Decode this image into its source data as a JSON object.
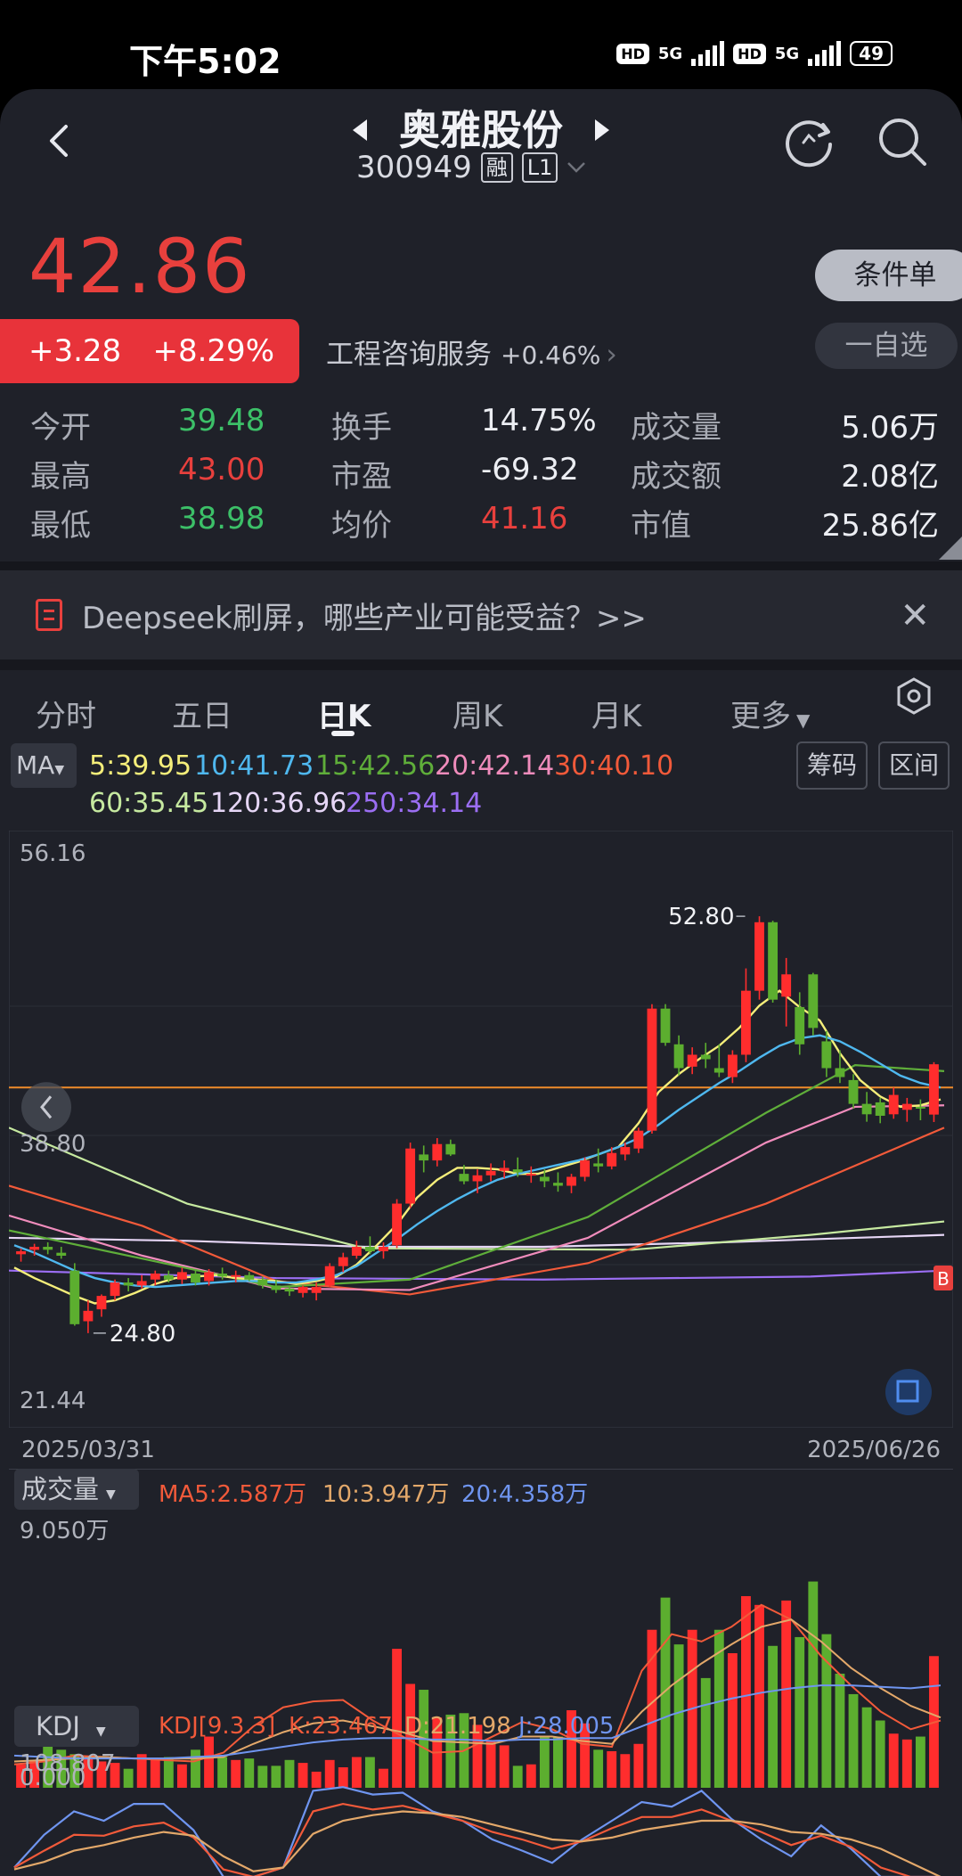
{
  "status_bar": {
    "time": "下午5:02",
    "sim1_label": "HD",
    "sim1_net": "5G",
    "sim2_label": "HD",
    "sim2_net": "5G",
    "battery": "49"
  },
  "header": {
    "title": "奥雅股份",
    "code": "300949",
    "tag_margin": "融",
    "tag_level": "L1"
  },
  "quote": {
    "price": "42.86",
    "change": "+3.28",
    "change_pct": "+8.29%",
    "industry": "工程咨询服务",
    "industry_pct": "+0.46%",
    "conditional_order": "条件单",
    "add_watch": "一自选"
  },
  "stats": {
    "open_label": "今开",
    "open": "39.48",
    "high_label": "最高",
    "high": "43.00",
    "low_label": "最低",
    "low": "38.98",
    "turnover_label": "换手",
    "turnover": "14.75%",
    "pe_label": "市盈",
    "pe": "-69.32",
    "avg_label": "均价",
    "avg": "41.16",
    "volume_label": "成交量",
    "volume": "5.06万",
    "amount_label": "成交额",
    "amount": "2.08亿",
    "mcap_label": "市值",
    "mcap": "25.86亿"
  },
  "banner": {
    "text": "Deepseek刷屏，哪些产业可能受益？>>"
  },
  "tabs": [
    "分时",
    "五日",
    "日K",
    "周K",
    "月K",
    "更多"
  ],
  "ma_legend": {
    "button": "MA",
    "ma5": "5:39.95",
    "ma10": "10:41.73",
    "ma15": "15:42.56",
    "ma20": "20:42.14",
    "ma30": "30:40.10",
    "ma60": "60:35.45",
    "ma120": "120:36.96",
    "ma250": "250:34.14",
    "chip_btn": "筹码",
    "range_btn": "区间",
    "colors": {
      "ma5": "#f5ee7a",
      "ma10": "#4fb8ef",
      "ma15": "#5fae3a",
      "ma20": "#f08cbc",
      "ma30": "#f25a3a",
      "ma60": "#c6e9a0",
      "ma120": "#e6d6f6",
      "ma250": "#9b6ef3"
    }
  },
  "chart_data": {
    "type": "candlestick",
    "y_top_label": "56.16",
    "y_mid_label": "38.80",
    "y_bottom_label": "21.44",
    "high_marker": "52.80",
    "low_marker": "24.80",
    "x_start": "2025/03/31",
    "x_end": "2025/06/26",
    "ylim": [
      21.44,
      56.16
    ],
    "reference_line": 41.3,
    "candles": [
      [
        30.1,
        30.5,
        29.6,
        30.3
      ],
      [
        30.4,
        30.8,
        30.0,
        30.6
      ],
      [
        30.6,
        30.9,
        30.1,
        30.4
      ],
      [
        30.2,
        30.6,
        29.8,
        30.0
      ],
      [
        29.0,
        29.5,
        25.3,
        25.4
      ],
      [
        25.6,
        27.0,
        24.8,
        26.3
      ],
      [
        26.4,
        27.4,
        25.9,
        27.3
      ],
      [
        27.3,
        28.4,
        27.0,
        28.2
      ],
      [
        28.2,
        28.5,
        27.6,
        28.0
      ],
      [
        28.0,
        28.7,
        27.8,
        28.3
      ],
      [
        28.4,
        29.0,
        28.0,
        28.8
      ],
      [
        28.7,
        29.0,
        28.2,
        28.4
      ],
      [
        28.4,
        29.2,
        28.1,
        28.9
      ],
      [
        28.8,
        29.0,
        28.0,
        28.2
      ],
      [
        28.3,
        29.1,
        28.0,
        28.9
      ],
      [
        28.8,
        29.2,
        28.4,
        28.6
      ],
      [
        28.6,
        29.0,
        28.2,
        28.7
      ],
      [
        28.7,
        28.9,
        28.3,
        28.4
      ],
      [
        28.4,
        28.6,
        27.8,
        28.0
      ],
      [
        28.0,
        28.4,
        27.5,
        27.7
      ],
      [
        27.8,
        28.0,
        27.3,
        27.6
      ],
      [
        27.5,
        28.0,
        27.2,
        27.9
      ],
      [
        27.5,
        28.2,
        27.0,
        27.9
      ],
      [
        28.0,
        29.5,
        27.9,
        29.3
      ],
      [
        29.3,
        30.2,
        28.9,
        29.9
      ],
      [
        30.0,
        31.0,
        29.8,
        30.6
      ],
      [
        30.6,
        31.3,
        30.1,
        30.3
      ],
      [
        30.3,
        30.9,
        29.8,
        30.6
      ],
      [
        30.7,
        33.8,
        30.5,
        33.5
      ],
      [
        33.5,
        37.6,
        33.2,
        37.2
      ],
      [
        36.8,
        37.4,
        35.6,
        36.4
      ],
      [
        36.4,
        37.9,
        36.0,
        37.5
      ],
      [
        37.5,
        37.8,
        36.7,
        36.8
      ],
      [
        35.5,
        36.1,
        34.8,
        35.0
      ],
      [
        35.0,
        35.8,
        34.2,
        35.4
      ],
      [
        35.4,
        36.2,
        35.0,
        35.7
      ],
      [
        35.7,
        36.4,
        35.2,
        35.9
      ],
      [
        35.8,
        36.6,
        35.3,
        35.6
      ],
      [
        35.4,
        36.0,
        34.9,
        35.5
      ],
      [
        35.3,
        35.8,
        34.6,
        35.0
      ],
      [
        34.9,
        35.6,
        34.3,
        34.7
      ],
      [
        34.7,
        35.5,
        34.2,
        35.3
      ],
      [
        35.3,
        36.6,
        35.0,
        36.4
      ],
      [
        36.2,
        37.2,
        35.6,
        36.0
      ],
      [
        36.0,
        37.3,
        35.8,
        36.9
      ],
      [
        36.8,
        37.6,
        36.4,
        37.3
      ],
      [
        37.2,
        38.6,
        36.9,
        38.4
      ],
      [
        38.4,
        46.9,
        38.2,
        46.6
      ],
      [
        46.6,
        46.9,
        44.1,
        44.3
      ],
      [
        44.2,
        44.8,
        42.1,
        42.6
      ],
      [
        42.7,
        44.0,
        42.2,
        43.5
      ],
      [
        43.5,
        44.3,
        42.6,
        43.2
      ],
      [
        42.6,
        44.2,
        42.0,
        42.3
      ],
      [
        42.0,
        43.8,
        41.6,
        43.5
      ],
      [
        43.5,
        49.3,
        43.0,
        47.8
      ],
      [
        47.8,
        52.8,
        47.2,
        52.4
      ],
      [
        52.4,
        52.5,
        47.0,
        47.2
      ],
      [
        47.4,
        50.0,
        45.4,
        48.9
      ],
      [
        46.7,
        47.7,
        43.5,
        44.2
      ],
      [
        48.9,
        49.0,
        44.8,
        45.3
      ],
      [
        44.4,
        45.1,
        42.0,
        42.6
      ],
      [
        42.6,
        43.8,
        41.6,
        42.0
      ],
      [
        41.8,
        42.2,
        39.9,
        40.2
      ],
      [
        40.2,
        41.0,
        39.0,
        39.5
      ],
      [
        40.3,
        40.6,
        38.9,
        39.4
      ],
      [
        39.5,
        41.3,
        39.2,
        40.8
      ],
      [
        39.8,
        40.6,
        39.0,
        40.2
      ],
      [
        40.0,
        40.5,
        39.1,
        39.9
      ],
      [
        39.48,
        43.0,
        38.98,
        42.86
      ]
    ],
    "ma_series": [
      {
        "name": "5",
        "color": "#f5ee7a",
        "values": [
          29.2,
          28.5,
          27.9,
          27.3,
          26.8,
          27.0,
          27.5,
          28.1,
          28.5,
          28.6,
          28.7,
          28.5,
          28.4,
          28.3,
          28.1,
          28.3,
          28.6,
          29.4,
          30.7,
          32.1,
          33.9,
          35.1,
          35.9,
          35.9,
          35.8,
          35.5,
          35.5,
          35.9,
          36.3,
          36.8,
          37.3,
          38.9,
          41.0,
          42.2,
          43.2,
          44.1,
          45.3,
          46.8,
          47.8,
          46.7,
          45.8,
          43.6,
          41.8,
          40.7,
          40.0,
          40.1,
          40.5
        ]
      },
      {
        "name": "10",
        "color": "#4fb8ef",
        "values": [
          30.7,
          30.2,
          29.6,
          29.0,
          28.5,
          28.2,
          28.0,
          27.9,
          28.0,
          28.1,
          28.2,
          28.3,
          28.3,
          28.2,
          28.2,
          28.4,
          28.7,
          29.3,
          30.2,
          31.1,
          32.1,
          33.0,
          33.8,
          34.5,
          35.1,
          35.5,
          35.8,
          36.1,
          36.4,
          36.8,
          37.3,
          37.9,
          38.8,
          39.8,
          40.7,
          41.6,
          42.4,
          43.3,
          44.1,
          44.6,
          44.8,
          44.4,
          43.7,
          42.9,
          42.1,
          41.6,
          41.3
        ]
      }
    ]
  },
  "volume_panel": {
    "button": "成交量",
    "ma5": "MA5:2.587万",
    "ma10": "10:3.947万",
    "ma20": "20:4.358万",
    "max_label": "9.050万",
    "zero_label": "0.000",
    "values": [
      1.6,
      1.9,
      3.2,
      2.6,
      2.3,
      2.1,
      1.8,
      1.7,
      1.3,
      2.3,
      1.9,
      2.1,
      1.6,
      2.6,
      3.5,
      2.1,
      1.9,
      2.0,
      1.5,
      1.5,
      1.9,
      1.7,
      1.1,
      1.9,
      1.4,
      2.1,
      2.1,
      1.3,
      9.5,
      7.1,
      6.7,
      4.8,
      5.0,
      5.1,
      4.3,
      3.2,
      2.9,
      1.5,
      1.6,
      3.5,
      3.5,
      5.3,
      4.4,
      2.6,
      2.5,
      2.3,
      3.0,
      10.8,
      13.0,
      9.8,
      10.8,
      7.5,
      10.8,
      9.2,
      13.1,
      12.5,
      9.7,
      12.8,
      10.3,
      14.1,
      10.5,
      7.8,
      6.4,
      5.5,
      4.6,
      3.7,
      3.3,
      3.5,
      9.0
    ]
  },
  "kdj_panel": {
    "button": "KDJ",
    "params": "KDJ[9.3.3]",
    "k": "K:23.467",
    "d": "D:21.198",
    "j": "J:28.005",
    "max_label": "108.807"
  }
}
